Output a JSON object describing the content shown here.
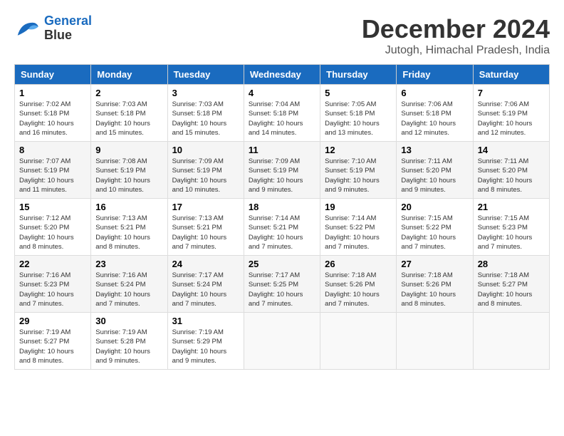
{
  "logo": {
    "line1": "General",
    "line2": "Blue"
  },
  "title": "December 2024",
  "location": "Jutogh, Himachal Pradesh, India",
  "weekdays": [
    "Sunday",
    "Monday",
    "Tuesday",
    "Wednesday",
    "Thursday",
    "Friday",
    "Saturday"
  ],
  "weeks": [
    [
      {
        "day": "1",
        "info": "Sunrise: 7:02 AM\nSunset: 5:18 PM\nDaylight: 10 hours\nand 16 minutes."
      },
      {
        "day": "2",
        "info": "Sunrise: 7:03 AM\nSunset: 5:18 PM\nDaylight: 10 hours\nand 15 minutes."
      },
      {
        "day": "3",
        "info": "Sunrise: 7:03 AM\nSunset: 5:18 PM\nDaylight: 10 hours\nand 15 minutes."
      },
      {
        "day": "4",
        "info": "Sunrise: 7:04 AM\nSunset: 5:18 PM\nDaylight: 10 hours\nand 14 minutes."
      },
      {
        "day": "5",
        "info": "Sunrise: 7:05 AM\nSunset: 5:18 PM\nDaylight: 10 hours\nand 13 minutes."
      },
      {
        "day": "6",
        "info": "Sunrise: 7:06 AM\nSunset: 5:18 PM\nDaylight: 10 hours\nand 12 minutes."
      },
      {
        "day": "7",
        "info": "Sunrise: 7:06 AM\nSunset: 5:19 PM\nDaylight: 10 hours\nand 12 minutes."
      }
    ],
    [
      {
        "day": "8",
        "info": "Sunrise: 7:07 AM\nSunset: 5:19 PM\nDaylight: 10 hours\nand 11 minutes."
      },
      {
        "day": "9",
        "info": "Sunrise: 7:08 AM\nSunset: 5:19 PM\nDaylight: 10 hours\nand 10 minutes."
      },
      {
        "day": "10",
        "info": "Sunrise: 7:09 AM\nSunset: 5:19 PM\nDaylight: 10 hours\nand 10 minutes."
      },
      {
        "day": "11",
        "info": "Sunrise: 7:09 AM\nSunset: 5:19 PM\nDaylight: 10 hours\nand 9 minutes."
      },
      {
        "day": "12",
        "info": "Sunrise: 7:10 AM\nSunset: 5:19 PM\nDaylight: 10 hours\nand 9 minutes."
      },
      {
        "day": "13",
        "info": "Sunrise: 7:11 AM\nSunset: 5:20 PM\nDaylight: 10 hours\nand 9 minutes."
      },
      {
        "day": "14",
        "info": "Sunrise: 7:11 AM\nSunset: 5:20 PM\nDaylight: 10 hours\nand 8 minutes."
      }
    ],
    [
      {
        "day": "15",
        "info": "Sunrise: 7:12 AM\nSunset: 5:20 PM\nDaylight: 10 hours\nand 8 minutes."
      },
      {
        "day": "16",
        "info": "Sunrise: 7:13 AM\nSunset: 5:21 PM\nDaylight: 10 hours\nand 8 minutes."
      },
      {
        "day": "17",
        "info": "Sunrise: 7:13 AM\nSunset: 5:21 PM\nDaylight: 10 hours\nand 7 minutes."
      },
      {
        "day": "18",
        "info": "Sunrise: 7:14 AM\nSunset: 5:21 PM\nDaylight: 10 hours\nand 7 minutes."
      },
      {
        "day": "19",
        "info": "Sunrise: 7:14 AM\nSunset: 5:22 PM\nDaylight: 10 hours\nand 7 minutes."
      },
      {
        "day": "20",
        "info": "Sunrise: 7:15 AM\nSunset: 5:22 PM\nDaylight: 10 hours\nand 7 minutes."
      },
      {
        "day": "21",
        "info": "Sunrise: 7:15 AM\nSunset: 5:23 PM\nDaylight: 10 hours\nand 7 minutes."
      }
    ],
    [
      {
        "day": "22",
        "info": "Sunrise: 7:16 AM\nSunset: 5:23 PM\nDaylight: 10 hours\nand 7 minutes."
      },
      {
        "day": "23",
        "info": "Sunrise: 7:16 AM\nSunset: 5:24 PM\nDaylight: 10 hours\nand 7 minutes."
      },
      {
        "day": "24",
        "info": "Sunrise: 7:17 AM\nSunset: 5:24 PM\nDaylight: 10 hours\nand 7 minutes."
      },
      {
        "day": "25",
        "info": "Sunrise: 7:17 AM\nSunset: 5:25 PM\nDaylight: 10 hours\nand 7 minutes."
      },
      {
        "day": "26",
        "info": "Sunrise: 7:18 AM\nSunset: 5:26 PM\nDaylight: 10 hours\nand 7 minutes."
      },
      {
        "day": "27",
        "info": "Sunrise: 7:18 AM\nSunset: 5:26 PM\nDaylight: 10 hours\nand 8 minutes."
      },
      {
        "day": "28",
        "info": "Sunrise: 7:18 AM\nSunset: 5:27 PM\nDaylight: 10 hours\nand 8 minutes."
      }
    ],
    [
      {
        "day": "29",
        "info": "Sunrise: 7:19 AM\nSunset: 5:27 PM\nDaylight: 10 hours\nand 8 minutes."
      },
      {
        "day": "30",
        "info": "Sunrise: 7:19 AM\nSunset: 5:28 PM\nDaylight: 10 hours\nand 9 minutes."
      },
      {
        "day": "31",
        "info": "Sunrise: 7:19 AM\nSunset: 5:29 PM\nDaylight: 10 hours\nand 9 minutes."
      },
      {
        "day": "",
        "info": ""
      },
      {
        "day": "",
        "info": ""
      },
      {
        "day": "",
        "info": ""
      },
      {
        "day": "",
        "info": ""
      }
    ]
  ]
}
